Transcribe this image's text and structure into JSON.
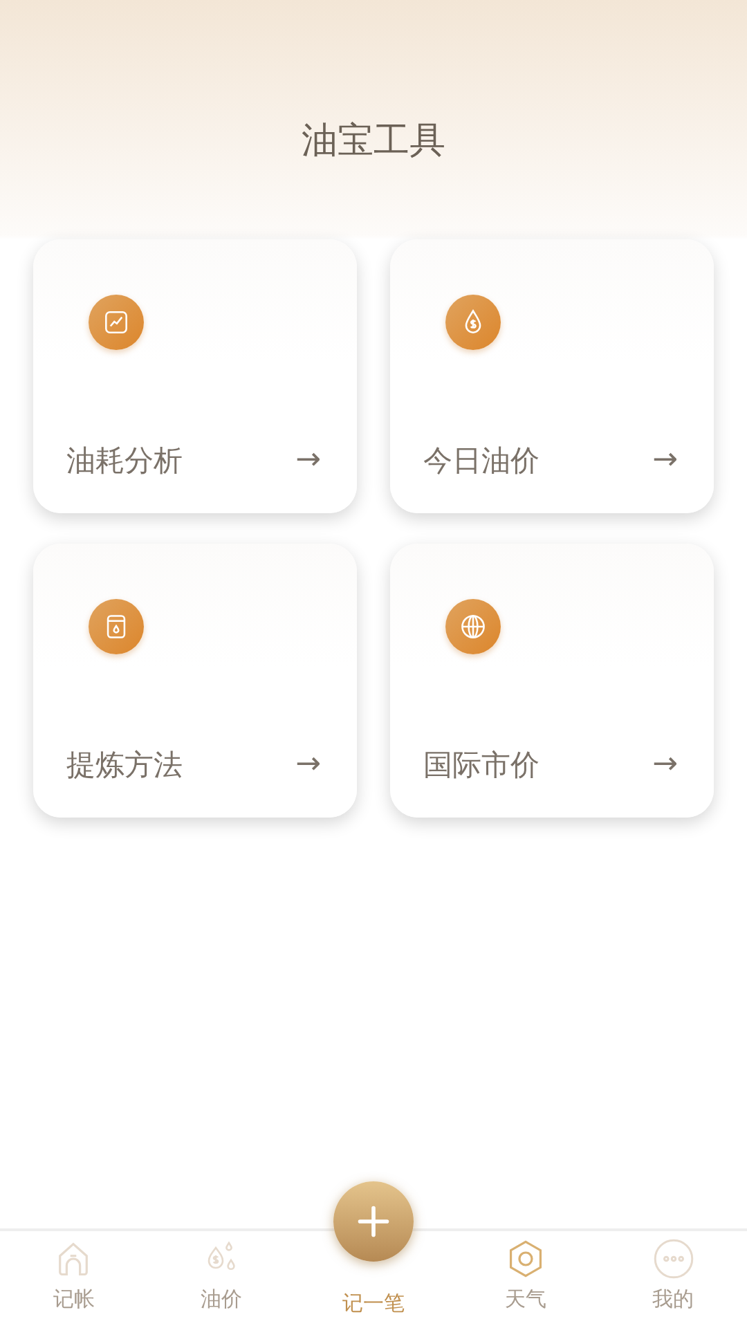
{
  "header": {
    "title": "油宝工具"
  },
  "tools": [
    {
      "kind": "chart",
      "label": "油耗分析",
      "arrow": "→"
    },
    {
      "kind": "drop",
      "label": "今日油价",
      "arrow": "→"
    },
    {
      "kind": "jar",
      "label": "提炼方法",
      "arrow": "→"
    },
    {
      "kind": "globe",
      "label": "国际市价",
      "arrow": "→"
    }
  ],
  "tab_bar": [
    {
      "kind": "home",
      "label": "记帐",
      "selected": false
    },
    {
      "kind": "drops",
      "label": "油价",
      "selected": false
    },
    {
      "kind": "add",
      "label": "记一笔",
      "selected": true
    },
    {
      "kind": "hexagon",
      "label": "天气",
      "selected": false
    },
    {
      "kind": "more",
      "label": "我的",
      "selected": false
    }
  ]
}
